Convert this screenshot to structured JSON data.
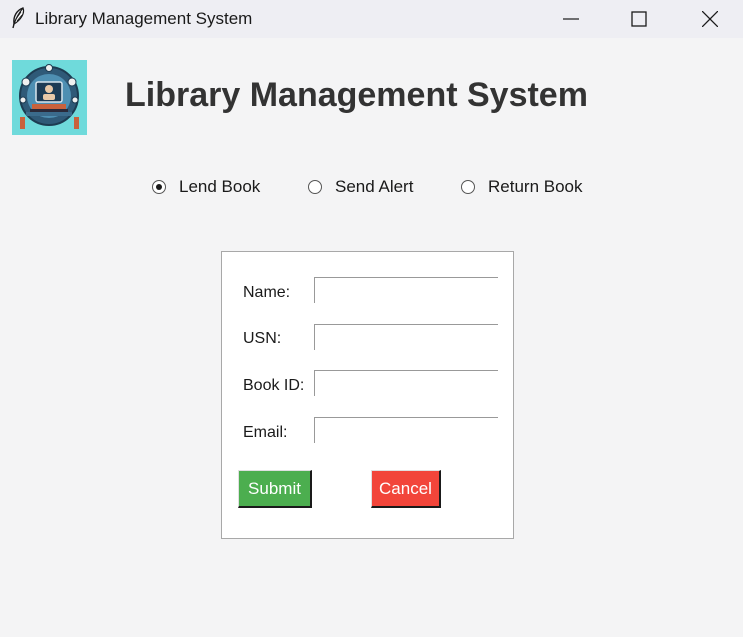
{
  "window": {
    "title": "Library Management System",
    "icon": "feather-icon",
    "controls": [
      "minimize-icon",
      "maximize-icon",
      "close-icon"
    ]
  },
  "header": {
    "title": "Library Management System",
    "logo": "library-logo-icon",
    "logo_bg": "#6fdadb"
  },
  "modes": {
    "options": [
      {
        "label": "Lend Book",
        "checked": true
      },
      {
        "label": "Send Alert",
        "checked": false
      },
      {
        "label": "Return Book",
        "checked": false
      }
    ]
  },
  "form": {
    "fields": [
      {
        "label": "Name:",
        "value": ""
      },
      {
        "label": "USN:",
        "value": ""
      },
      {
        "label": "Book ID:",
        "value": ""
      },
      {
        "label": "Email:",
        "value": ""
      }
    ],
    "submit_label": "Submit",
    "cancel_label": "Cancel",
    "submit_color": "#4cae4f",
    "cancel_color": "#f2453a"
  }
}
